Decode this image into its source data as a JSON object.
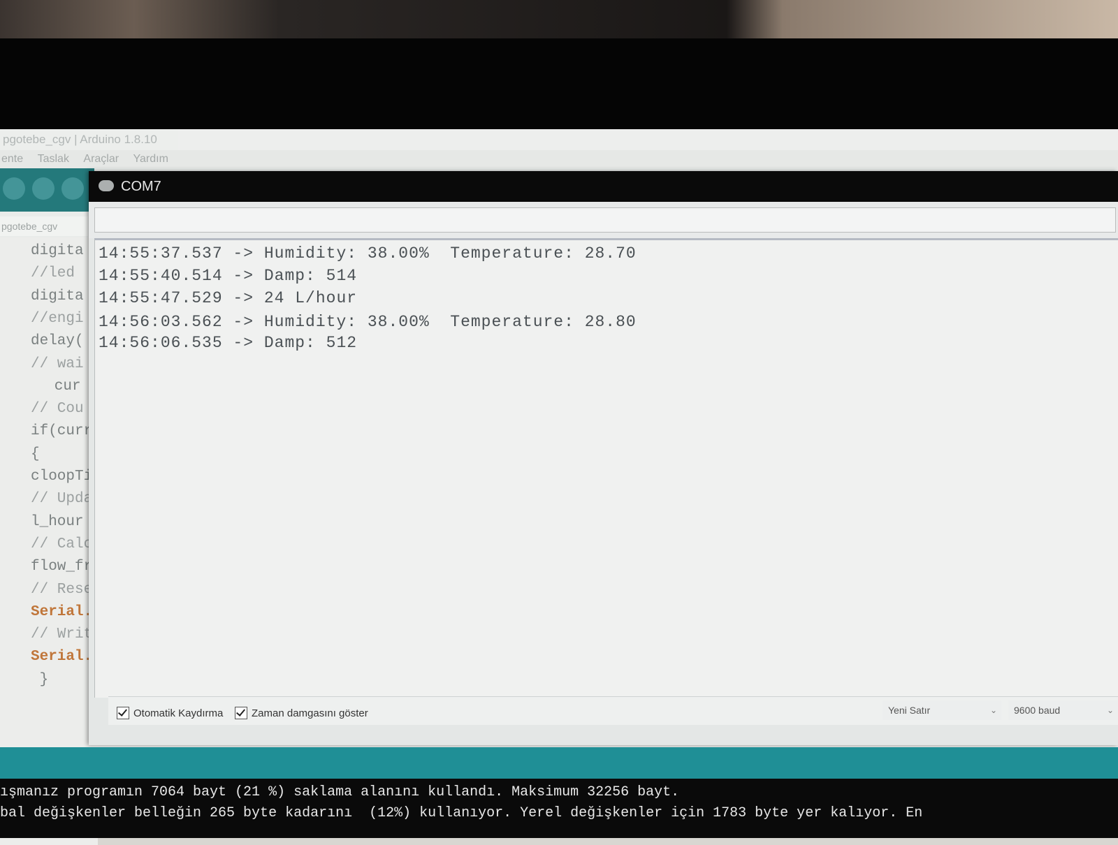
{
  "ide": {
    "window_title": "pgotebe_cgv | Arduino 1.8.10",
    "menu": [
      "ente",
      "Taslak",
      "Araçlar",
      "Yardım"
    ],
    "tab_label": "pgotebe_cgv",
    "code_lines": [
      {
        "text": "digita",
        "kind": "code"
      },
      {
        "text": "//led",
        "kind": "comment"
      },
      {
        "text": "digita",
        "kind": "code"
      },
      {
        "text": "//engi",
        "kind": "comment"
      },
      {
        "text": "delay(",
        "kind": "code"
      },
      {
        "text": "// wai",
        "kind": "comment"
      },
      {
        "text": "   cur",
        "kind": "code"
      },
      {
        "text": "// Cou",
        "kind": "comment"
      },
      {
        "text": "if(curr",
        "kind": "code"
      },
      {
        "text": "{",
        "kind": "code"
      },
      {
        "text": "cloopTi",
        "kind": "code"
      },
      {
        "text": "// Upda",
        "kind": "comment"
      },
      {
        "text": "l_hour",
        "kind": "code"
      },
      {
        "text": "// Calc",
        "kind": "comment"
      },
      {
        "text": "flow_fr",
        "kind": "code"
      },
      {
        "text": "// Rese",
        "kind": "comment"
      },
      {
        "text": "Serial.",
        "kind": "keyword"
      },
      {
        "text": "// Writ",
        "kind": "comment"
      },
      {
        "text": "Serial.",
        "kind": "keyword"
      },
      {
        "text": " }",
        "kind": "code"
      }
    ]
  },
  "serial_monitor": {
    "title": "COM7",
    "input_value": "",
    "output_lines": [
      "14:55:37.537 -> Humidity: 38.00%  Temperature: 28.70",
      "14:55:40.514 -> Damp: 514",
      "14:55:47.529 -> 24 L/hour",
      "14:56:03.562 -> Humidity: 38.00%  Temperature: 28.80",
      "14:56:06.535 -> Damp: 512"
    ],
    "autoscroll_label": "Otomatik Kaydırma",
    "autoscroll_checked": true,
    "timestamp_label": "Zaman damgasını göster",
    "timestamp_checked": true,
    "line_ending": "Yeni Satır",
    "baud_rate": "9600 baud"
  },
  "console": {
    "line1": "ışmanız programın 7064 bayt (21 %) saklama alanını kullandı. Maksimum 32256 bayt.",
    "line2": "bal değişkenler belleğin 265 byte kadarını  (12%) kullanıyor. Yerel değişkenler için 1783 byte yer kalıyor. En"
  },
  "colors": {
    "accent_teal": "#1f8f96",
    "toolbar_teal": "#24797b",
    "keyword_orange": "#c0763a"
  }
}
